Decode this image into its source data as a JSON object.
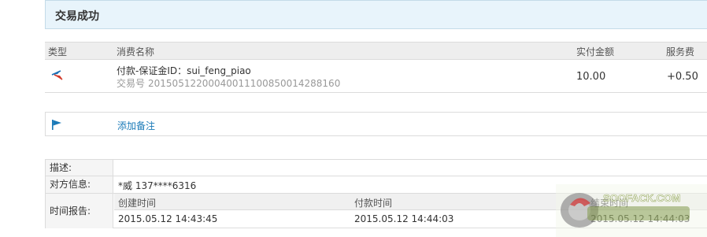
{
  "banner": {
    "title": "交易成功"
  },
  "table": {
    "headers": {
      "type": "类型",
      "name": "消费名称",
      "amount": "实付金额",
      "fee": "服务费"
    },
    "row": {
      "type_icon": "transfer-arrow-icon",
      "name": "付款-保证金ID：sui_feng_piao",
      "trade_no_label": "交易号",
      "trade_no": "20150512200040011100850014288160",
      "amount": "10.00",
      "fee": "+0.50"
    }
  },
  "remark": {
    "icon": "flag-icon",
    "label": "添加备注"
  },
  "info": {
    "desc_label": "描述:",
    "desc_value": "",
    "party_label": "对方信息:",
    "party_value": "*威 137****6316",
    "time_label": "时间报告:",
    "times": [
      {
        "label": "创建时间",
        "value": "2015.05.12 14:43:45"
      },
      {
        "label": "付款时间",
        "value": "2015.05.12 14:44:03"
      },
      {
        "label": "结束时间",
        "value": "2015.05.12 14:44:03"
      }
    ]
  },
  "watermark": {
    "text": "SOOFACK.COM"
  },
  "colors": {
    "banner_bg": "#e8f4fb",
    "link": "#1a7ab8",
    "header_bg": "#eeeeee"
  }
}
